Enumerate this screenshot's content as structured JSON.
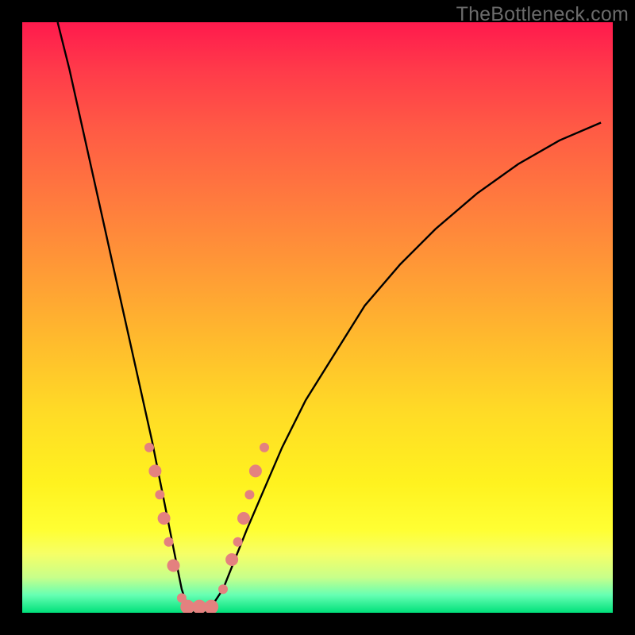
{
  "watermark": "TheBottleneck.com",
  "chart_data": {
    "type": "line",
    "title": "",
    "xlabel": "",
    "ylabel": "",
    "xlim": [
      0,
      100
    ],
    "ylim": [
      0,
      100
    ],
    "series": [
      {
        "name": "curve",
        "x": [
          6,
          8,
          10,
          12,
          14,
          16,
          18,
          20,
          22,
          23,
          24,
          25,
          26,
          27,
          28,
          29,
          30,
          31,
          32,
          34,
          36,
          38,
          41,
          44,
          48,
          53,
          58,
          64,
          70,
          77,
          84,
          91,
          98
        ],
        "y": [
          100,
          92,
          83,
          74,
          65,
          56,
          47,
          38,
          29,
          24,
          19,
          14,
          9,
          4,
          1,
          0,
          0,
          0,
          1,
          4,
          9,
          14,
          21,
          28,
          36,
          44,
          52,
          59,
          65,
          71,
          76,
          80,
          83
        ]
      }
    ],
    "markers": [
      {
        "x": 21.5,
        "y": 28,
        "r": 6
      },
      {
        "x": 22.5,
        "y": 24,
        "r": 8
      },
      {
        "x": 23.3,
        "y": 20,
        "r": 6
      },
      {
        "x": 24.0,
        "y": 16,
        "r": 8
      },
      {
        "x": 24.8,
        "y": 12,
        "r": 6
      },
      {
        "x": 25.6,
        "y": 8,
        "r": 8
      },
      {
        "x": 27.0,
        "y": 2.5,
        "r": 6
      },
      {
        "x": 28.0,
        "y": 1,
        "r": 9
      },
      {
        "x": 30.0,
        "y": 1,
        "r": 9
      },
      {
        "x": 32.0,
        "y": 1,
        "r": 9
      },
      {
        "x": 34.0,
        "y": 4,
        "r": 6
      },
      {
        "x": 35.5,
        "y": 9,
        "r": 8
      },
      {
        "x": 36.5,
        "y": 12,
        "r": 6
      },
      {
        "x": 37.5,
        "y": 16,
        "r": 8
      },
      {
        "x": 38.5,
        "y": 20,
        "r": 6
      },
      {
        "x": 39.5,
        "y": 24,
        "r": 8
      },
      {
        "x": 41.0,
        "y": 28,
        "r": 6
      }
    ],
    "marker_color": "#e4817f",
    "curve_color": "#000000"
  }
}
